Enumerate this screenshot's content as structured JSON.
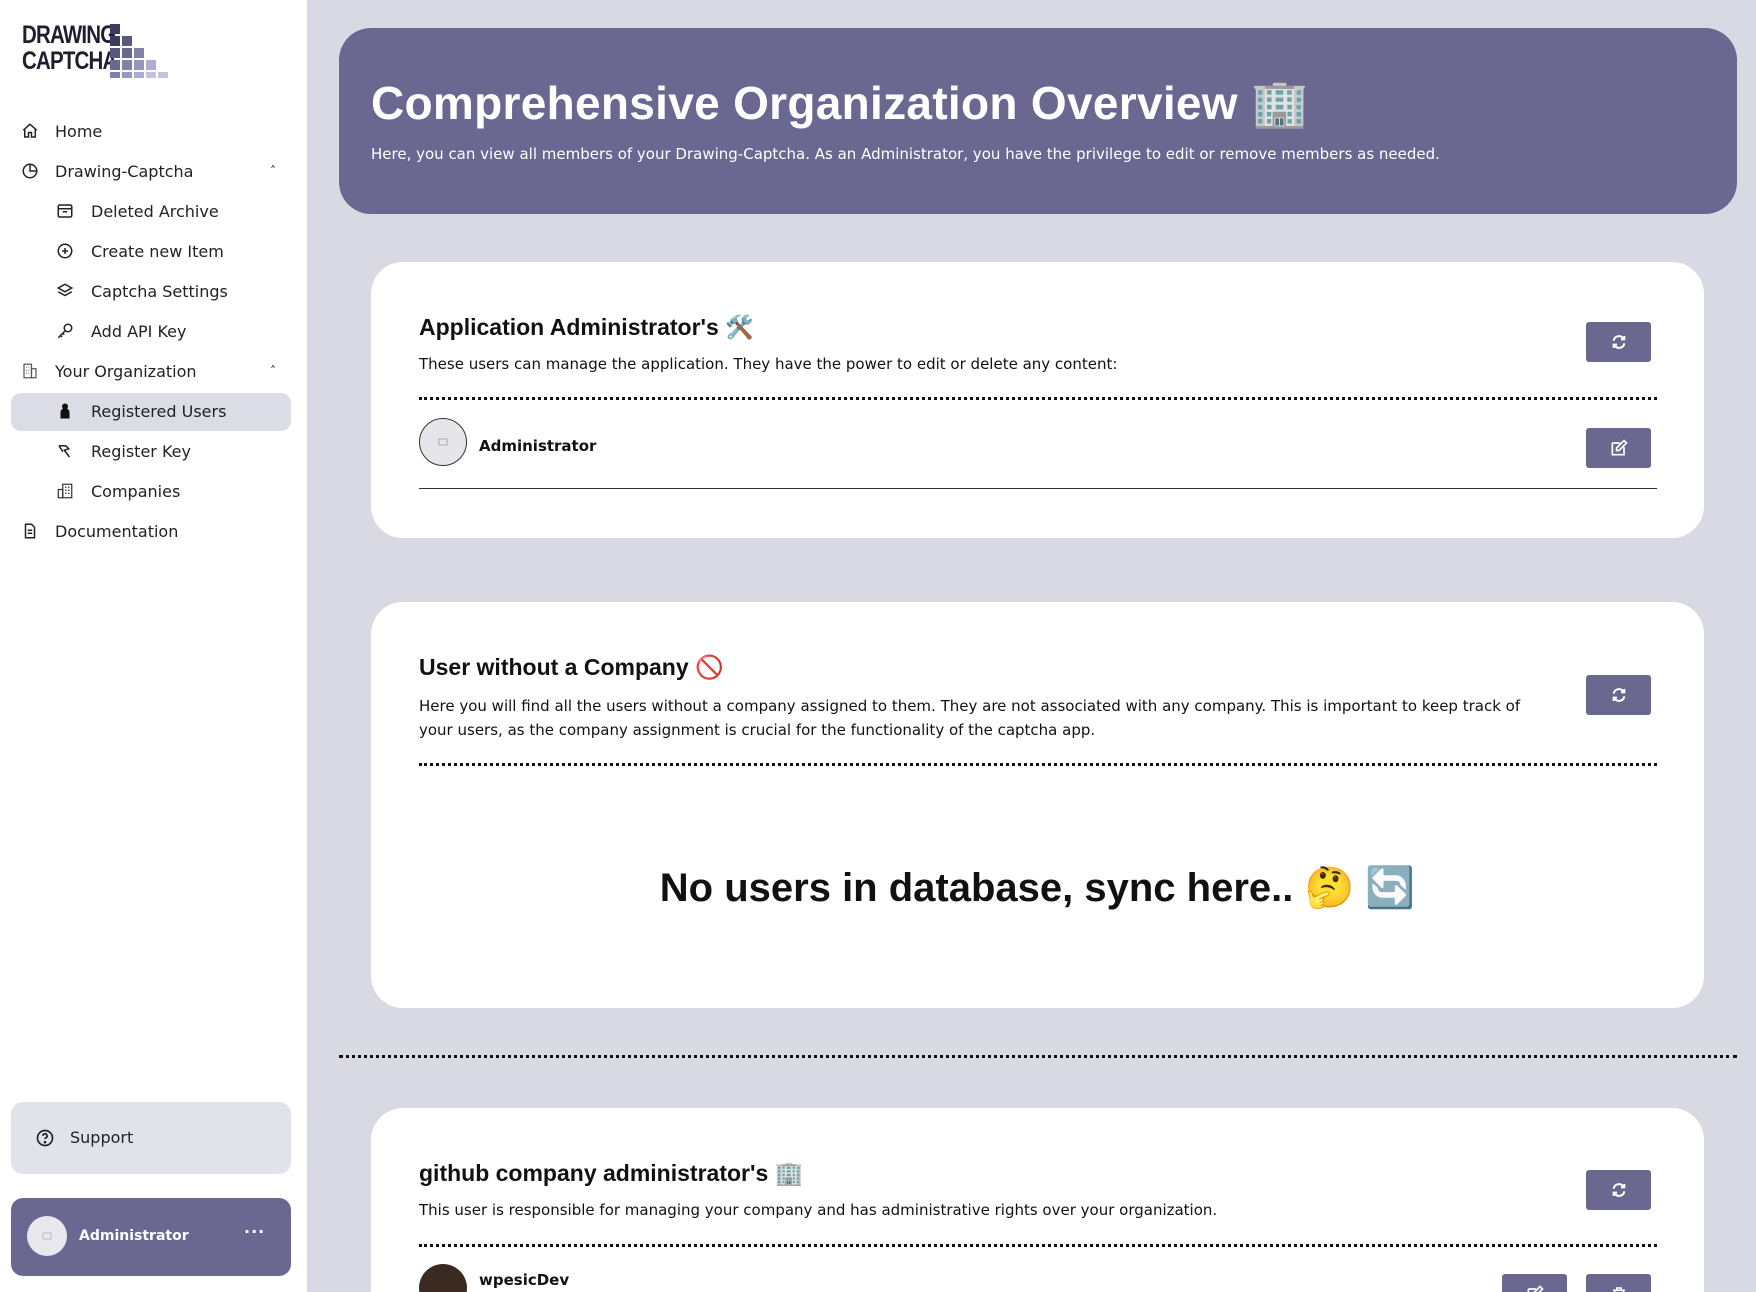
{
  "logo": {
    "line1": "DRAWING",
    "line2": "CAPTCHA"
  },
  "nav": {
    "home": "Home",
    "drawing_captcha": "Drawing-Captcha",
    "deleted_archive": "Deleted Archive",
    "create_new_item": "Create new Item",
    "captcha_settings": "Captcha Settings",
    "add_api_key": "Add API Key",
    "your_organization": "Your Organization",
    "registered_users": "Registered Users",
    "register_key": "Register Key",
    "companies": "Companies",
    "documentation": "Documentation"
  },
  "support": {
    "label": "Support"
  },
  "user": {
    "name": "Administrator",
    "more": "···"
  },
  "hero": {
    "title": "Comprehensive Organization Overview 🏢",
    "subtitle": "Here, you can view all members of your Drawing-Captcha. As an Administrator, you have the privilege to edit or remove members as needed."
  },
  "app_admins": {
    "title": "Application Administrator's 🛠️",
    "description": "These users can manage the application. They have the power to edit or delete any content:",
    "members": [
      {
        "name": "Administrator"
      }
    ]
  },
  "no_company": {
    "title": "User without a Company 🚫",
    "description": "Here you will find all the users without a company assigned to them. They are not associated with any company. This is important to keep track of your users, as the company assignment is crucial for the functionality of the captcha app.",
    "empty_message": "No users in database, sync here.. 🤔 🔄"
  },
  "company_admins": {
    "title": "github company administrator's 🏢",
    "description": "This user is responsible for managing your company and has administrative rights over your organization.",
    "members": [
      {
        "name": "wpesicDev"
      }
    ]
  },
  "colors": {
    "accent": "#6a6890",
    "background": "#d9d9e3",
    "active_nav": "#dcdce6"
  }
}
